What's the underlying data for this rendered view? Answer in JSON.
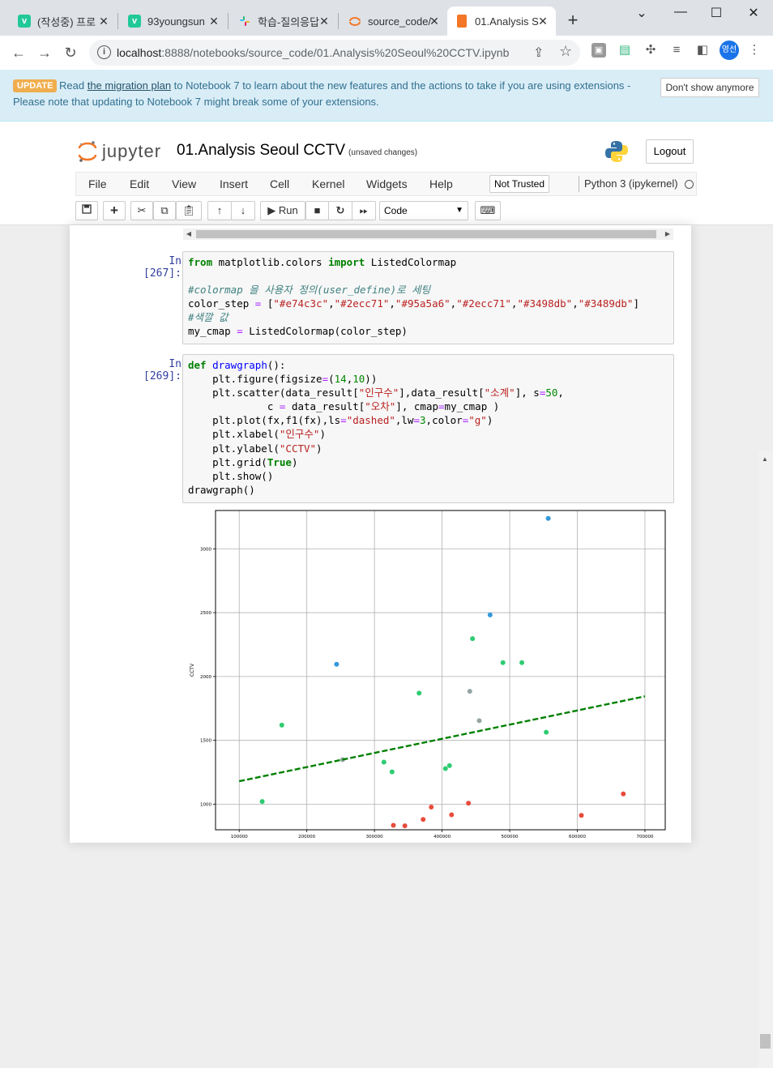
{
  "browser": {
    "tabs": [
      {
        "title": "(작성중) 프로",
        "favicon_letter": "v",
        "favicon_color": "#20c997"
      },
      {
        "title": "93youngsun",
        "favicon_letter": "v",
        "favicon_color": "#20c997"
      },
      {
        "title": "학습-질의응답",
        "favicon_letter": "",
        "favicon_color": "#e01e5a"
      },
      {
        "title": "source_code/",
        "favicon_letter": "",
        "favicon_color": "#f37726"
      },
      {
        "title": "01.Analysis S",
        "favicon_letter": "",
        "favicon_color": "#f37726"
      }
    ],
    "url_host": "localhost",
    "url_path": ":8888/notebooks/source_code/01.Analysis%20Seoul%20CCTV.ipynb",
    "profile_label": "영선"
  },
  "banner": {
    "badge": "UPDATE",
    "text_before": "Read",
    "link": "the migration plan",
    "text_after": "to Notebook 7 to learn about the new features and the actions to take if you are using extensions - Please note that updating to Notebook 7 might break some of your extensions.",
    "dismiss": "Don't show anymore"
  },
  "jupyter": {
    "logo_text": "jupyter",
    "notebook_title": "01.Analysis Seoul CCTV",
    "save_status": "(unsaved changes)",
    "logout": "Logout",
    "menu": [
      "File",
      "Edit",
      "View",
      "Insert",
      "Cell",
      "Kernel",
      "Widgets",
      "Help"
    ],
    "trust": "Not Trusted",
    "kernel": "Python 3 (ipykernel)",
    "run_label": "Run",
    "cell_type": "Code"
  },
  "cells": [
    {
      "prompt": "In [267]:"
    },
    {
      "prompt": "In [269]:"
    }
  ],
  "chart_data": {
    "type": "scatter",
    "title": "",
    "xlabel": "",
    "ylabel": "CCTV",
    "xlim": [
      65000,
      730000
    ],
    "ylim": [
      800,
      3300
    ],
    "grid": true,
    "x_ticks": [
      100000,
      200000,
      300000,
      400000,
      500000,
      600000,
      700000
    ],
    "y_ticks": [
      1000,
      1500,
      2000,
      2500,
      3000
    ],
    "x_tick_labels": [
      "100000",
      "200000",
      "300000",
      "400000",
      "500000",
      "600000",
      "700000"
    ],
    "y_tick_labels": [
      "1000",
      "1500",
      "2000",
      "2500",
      "3000"
    ],
    "points": [
      {
        "x": 557000,
        "y": 3238,
        "color": "#3498db"
      },
      {
        "x": 471000,
        "y": 2482,
        "color": "#3498db"
      },
      {
        "x": 244000,
        "y": 2096,
        "color": "#3498db"
      },
      {
        "x": 445000,
        "y": 2297,
        "color": "#2ecc71"
      },
      {
        "x": 490000,
        "y": 2109,
        "color": "#2ecc71"
      },
      {
        "x": 518000,
        "y": 2109,
        "color": "#2ecc71"
      },
      {
        "x": 366000,
        "y": 1870,
        "color": "#2ecc71"
      },
      {
        "x": 163000,
        "y": 1619,
        "color": "#2ecc71"
      },
      {
        "x": 554000,
        "y": 1564,
        "color": "#2ecc71"
      },
      {
        "x": 314000,
        "y": 1330,
        "color": "#2ecc71"
      },
      {
        "x": 326000,
        "y": 1254,
        "color": "#2ecc71"
      },
      {
        "x": 405000,
        "y": 1279,
        "color": "#2ecc71"
      },
      {
        "x": 411000,
        "y": 1302,
        "color": "#2ecc71"
      },
      {
        "x": 134000,
        "y": 1021,
        "color": "#2ecc71"
      },
      {
        "x": 441000,
        "y": 1884,
        "color": "#95a5a6"
      },
      {
        "x": 455000,
        "y": 1654,
        "color": "#95a5a6"
      },
      {
        "x": 253000,
        "y": 1349,
        "color": "#95a5a6"
      },
      {
        "x": 668000,
        "y": 1081,
        "color": "#e74c3c"
      },
      {
        "x": 606000,
        "y": 913,
        "color": "#e74c3c"
      },
      {
        "x": 439000,
        "y": 1008,
        "color": "#e74c3c"
      },
      {
        "x": 384000,
        "y": 978,
        "color": "#e74c3c"
      },
      {
        "x": 414000,
        "y": 917,
        "color": "#e74c3c"
      },
      {
        "x": 372000,
        "y": 881,
        "color": "#e74c3c"
      },
      {
        "x": 328000,
        "y": 835,
        "color": "#e74c3c"
      },
      {
        "x": 345000,
        "y": 831,
        "color": "#e74c3c"
      }
    ],
    "trend_line": {
      "x": [
        100000,
        700000
      ],
      "y": [
        1180,
        1845
      ],
      "color": "#008000",
      "style": "dashed"
    }
  }
}
